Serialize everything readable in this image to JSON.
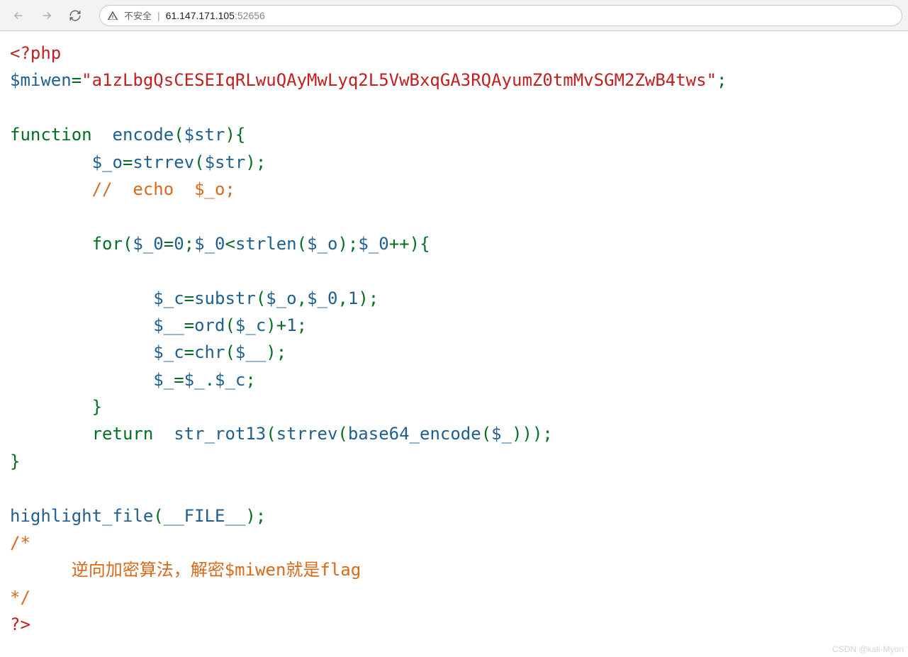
{
  "toolbar": {
    "insecure_label": "不安全",
    "url_host": "61.147.171.105",
    "url_port": ":52656"
  },
  "code": {
    "open_tag": "<?php",
    "var_miwen": "$miwen",
    "eq": "=",
    "quote": "\"",
    "miwen_value": "a1zLbgQsCESEIqRLwuQAyMwLyq2L5VwBxqGA3RQAyumZ0tmMvSGM2ZwB4tws",
    "semicolon": ";",
    "kw_function": "function",
    "fn_encode": "encode",
    "var_str": "$str",
    "var__o": "$_o",
    "fn_strrev": "strrev",
    "comment_echo": "//  echo  $_o;",
    "kw_for": "for",
    "var__0": "$_0",
    "zero": "0",
    "lt": "<",
    "fn_strlen": "strlen",
    "plusplus": "++",
    "var__c": "$_c",
    "fn_substr": "substr",
    "one": "1",
    "var___": "$__",
    "fn_ord": "ord",
    "plus": "+",
    "fn_chr": "chr",
    "var__": "$_",
    "dot": ".",
    "kw_return": "return",
    "fn_rot13": "str_rot13",
    "fn_b64": "base64_encode",
    "fn_highlight": "highlight_file",
    "const_file": "__FILE__",
    "comment_open": "/*",
    "comment_body": "逆向加密算法，解密$miwen就是flag",
    "comment_close": "*/",
    "close_tag": "?>"
  },
  "watermark": "CSDN @kali-Myon"
}
